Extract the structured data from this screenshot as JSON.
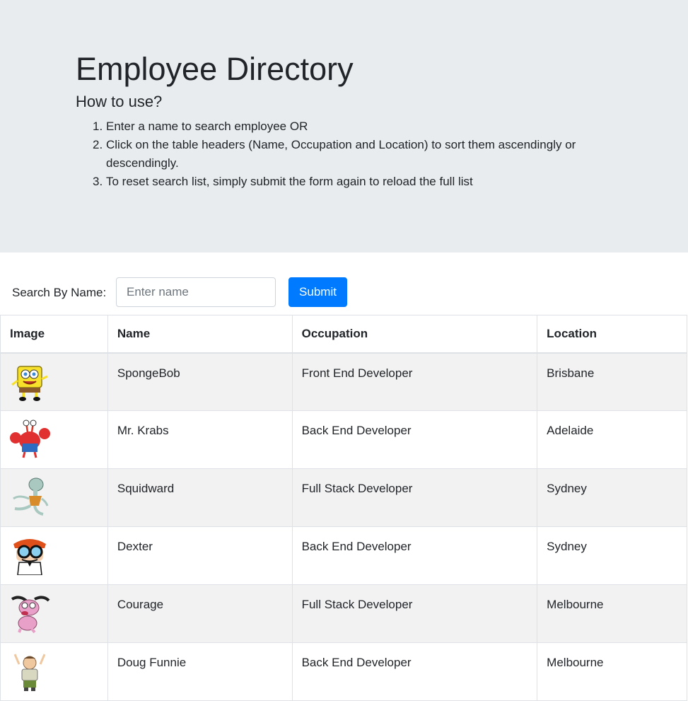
{
  "header": {
    "title": "Employee Directory",
    "subtitle": "How to use?",
    "instructions": [
      "Enter a name to search employee OR",
      "Click on the table headers (Name, Occupation and Location) to sort them ascendingly or descendingly.",
      "To reset search list, simply submit the form again to reload the full list"
    ],
    "instruction_numbers": [
      "1.",
      "2.",
      "3."
    ]
  },
  "search": {
    "label": "Search By Name:",
    "value": "",
    "placeholder": "Enter name",
    "submit_label": "Submit"
  },
  "colors": {
    "jumbotron_bg": "#e9ecef",
    "accent": "#007bff",
    "stripe": "#f2f2f2"
  },
  "table": {
    "headers": [
      "Image",
      "Name",
      "Occupation",
      "Location"
    ],
    "rows": [
      {
        "image": "spongebob-avatar",
        "name": "SpongeBob",
        "occupation": "Front End Developer",
        "location": "Brisbane"
      },
      {
        "image": "mr-krabs-avatar",
        "name": "Mr. Krabs",
        "occupation": "Back End Developer",
        "location": "Adelaide"
      },
      {
        "image": "squidward-avatar",
        "name": "Squidward",
        "occupation": "Full Stack Developer",
        "location": "Sydney"
      },
      {
        "image": "dexter-avatar",
        "name": "Dexter",
        "occupation": "Back End Developer",
        "location": "Sydney"
      },
      {
        "image": "courage-avatar",
        "name": "Courage",
        "occupation": "Full Stack Developer",
        "location": "Melbourne"
      },
      {
        "image": "doug-funnie-avatar",
        "name": "Doug Funnie",
        "occupation": "Back End Developer",
        "location": "Melbourne"
      }
    ]
  }
}
